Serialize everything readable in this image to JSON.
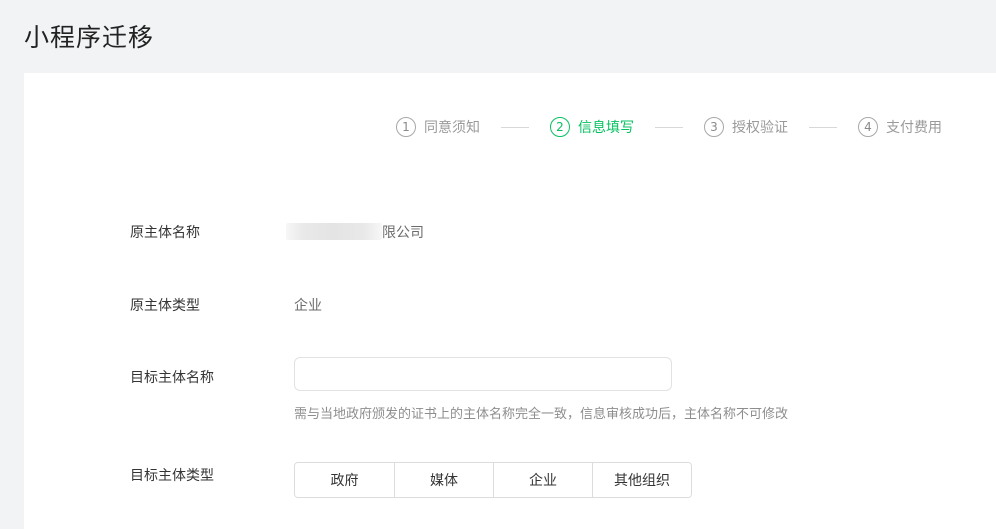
{
  "page": {
    "title": "小程序迁移"
  },
  "steps": [
    {
      "num": "1",
      "label": "同意须知",
      "active": false
    },
    {
      "num": "2",
      "label": "信息填写",
      "active": true
    },
    {
      "num": "3",
      "label": "授权验证",
      "active": false
    },
    {
      "num": "4",
      "label": "支付费用",
      "active": false
    }
  ],
  "form": {
    "original_name": {
      "label": "原主体名称",
      "value_suffix": "限公司"
    },
    "original_type": {
      "label": "原主体类型",
      "value": "企业"
    },
    "target_name": {
      "label": "目标主体名称",
      "value": "",
      "placeholder": "",
      "hint": "需与当地政府颁发的证书上的主体名称完全一致，信息审核成功后，主体名称不可修改"
    },
    "target_type": {
      "label": "目标主体类型",
      "options": [
        "政府",
        "媒体",
        "企业",
        "其他组织"
      ]
    }
  },
  "colors": {
    "accent": "#07c160",
    "background": "#f2f3f5",
    "card": "#ffffff"
  }
}
